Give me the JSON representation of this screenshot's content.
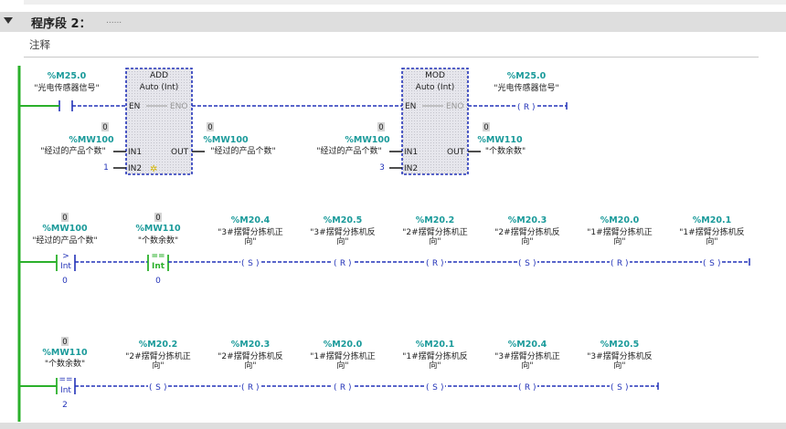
{
  "network": {
    "title": "程序段 2：",
    "dots": "......",
    "comment": "注释"
  },
  "rung1": {
    "contact": {
      "addr": "%M25.0",
      "sym": "\"光电传感器信号\""
    },
    "add": {
      "title": "ADD",
      "type": "Auto (Int)",
      "en": "EN",
      "eno": "ENO",
      "in1": "IN1",
      "in2": "IN2",
      "out": "OUT",
      "in1_status": "0",
      "in1_addr": "%MW100",
      "in1_sym": "\"经过的产品个数\"",
      "in2_val": "1",
      "out_status": "0",
      "out_addr": "%MW100",
      "out_sym": "\"经过的产品个数\""
    },
    "mod": {
      "title": "MOD",
      "type": "Auto (Int)",
      "en": "EN",
      "eno": "ENO",
      "in1": "IN1",
      "in2": "IN2",
      "out": "OUT",
      "in1_status": "0",
      "in1_addr": "%MW100",
      "in1_sym": "\"经过的产品个数\"",
      "in2_val": "3",
      "out_status": "0",
      "out_addr": "%MW110",
      "out_sym": "\"个数余数\""
    },
    "coil": {
      "addr": "%M25.0",
      "sym": "\"光电传感器信号\"",
      "type": "R"
    }
  },
  "rung2": {
    "cmp1": {
      "status": "0",
      "addr": "%MW100",
      "sym": "\"经过的产品个数\"",
      "op": ">",
      "type": "Int",
      "value": "0"
    },
    "cmp2": {
      "status": "0",
      "addr": "%MW110",
      "sym": "\"个数余数\"",
      "op": "==",
      "type": "Int",
      "value": "0"
    },
    "coils": [
      {
        "addr": "%M20.4",
        "sym1": "\"3#摆臂分拣机正",
        "sym2": "向\"",
        "type": "S"
      },
      {
        "addr": "%M20.5",
        "sym1": "\"3#摆臂分拣机反",
        "sym2": "向\"",
        "type": "R"
      },
      {
        "addr": "%M20.2",
        "sym1": "\"2#摆臂分拣机正",
        "sym2": "向\"",
        "type": "R"
      },
      {
        "addr": "%M20.3",
        "sym1": "\"2#摆臂分拣机反",
        "sym2": "向\"",
        "type": "S"
      },
      {
        "addr": "%M20.0",
        "sym1": "\"1#摆臂分拣机正",
        "sym2": "向\"",
        "type": "R"
      },
      {
        "addr": "%M20.1",
        "sym1": "\"1#摆臂分拣机反",
        "sym2": "向\"",
        "type": "S"
      }
    ]
  },
  "rung3": {
    "cmp": {
      "status": "0",
      "addr": "%MW110",
      "sym": "\"个数余数\"",
      "op": "==",
      "type": "Int",
      "value": "2"
    },
    "coils": [
      {
        "addr": "%M20.2",
        "sym1": "\"2#摆臂分拣机正",
        "sym2": "向\"",
        "type": "S"
      },
      {
        "addr": "%M20.3",
        "sym1": "\"2#摆臂分拣机反",
        "sym2": "向\"",
        "type": "R"
      },
      {
        "addr": "%M20.0",
        "sym1": "\"1#摆臂分拣机正",
        "sym2": "向\"",
        "type": "R"
      },
      {
        "addr": "%M20.1",
        "sym1": "\"1#摆臂分拣机反",
        "sym2": "向\"",
        "type": "S"
      },
      {
        "addr": "%M20.4",
        "sym1": "\"3#摆臂分拣机正",
        "sym2": "向\"",
        "type": "R"
      },
      {
        "addr": "%M20.5",
        "sym1": "\"3#摆臂分拣机反",
        "sym2": "向\"",
        "type": "S"
      }
    ]
  }
}
